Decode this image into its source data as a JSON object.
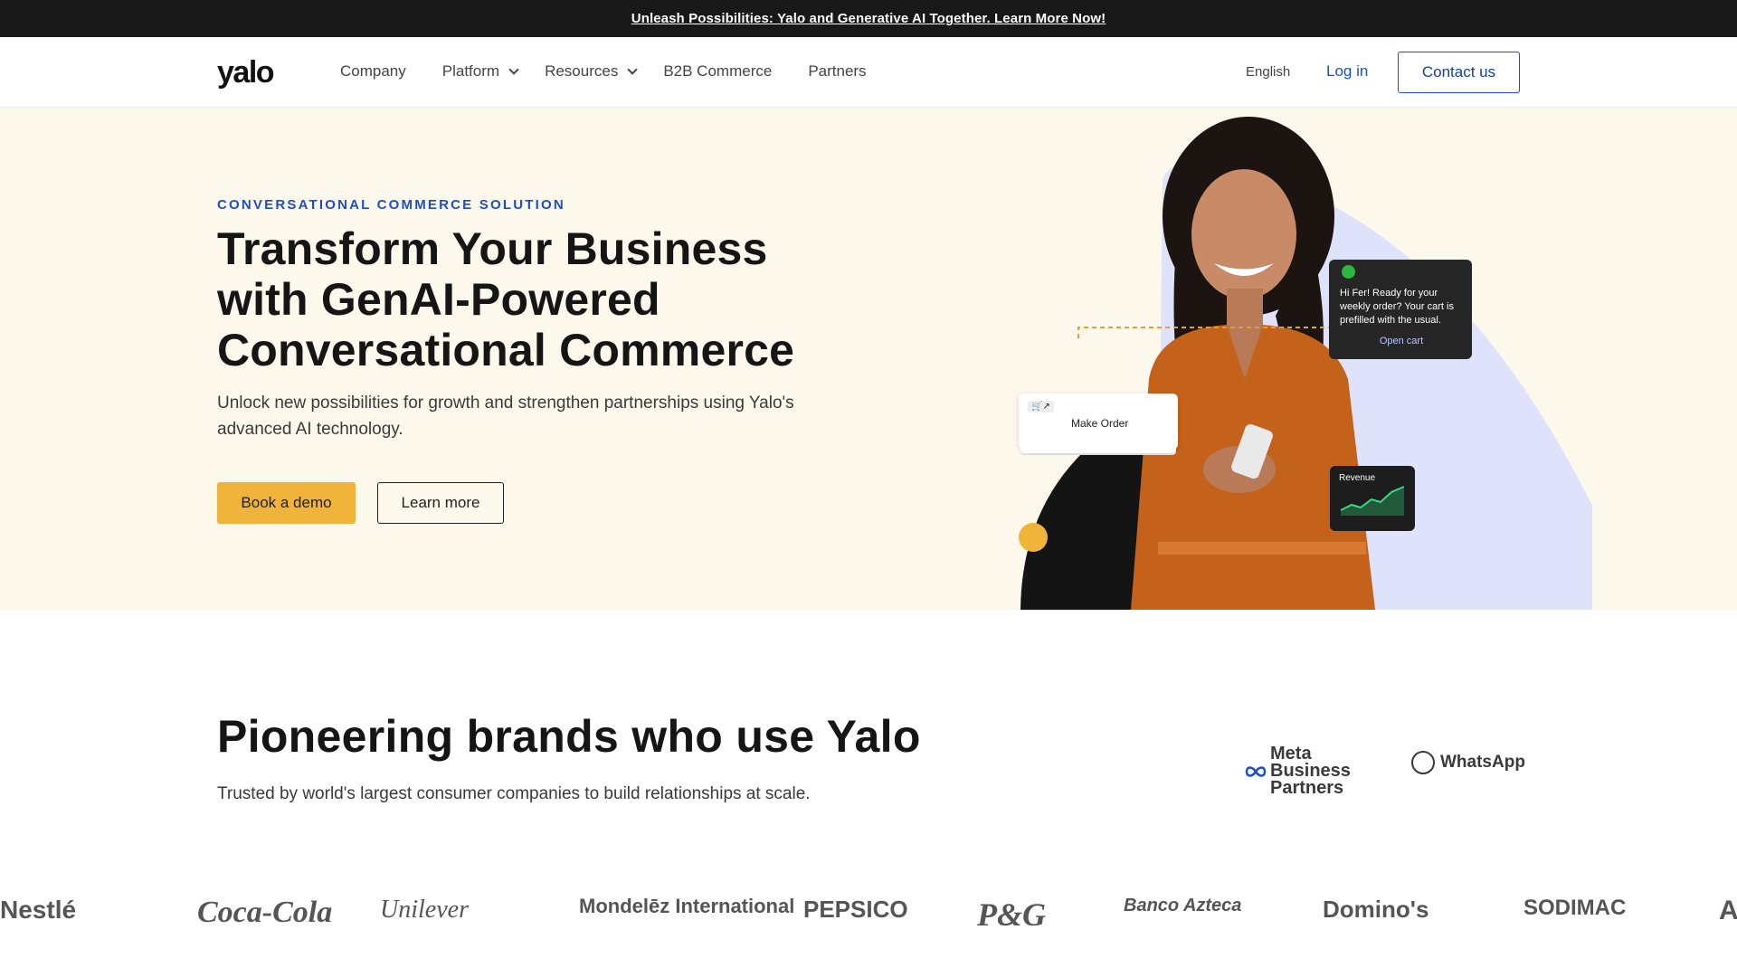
{
  "announcement": {
    "text": "Unleash Possibilities: Yalo and Generative AI Together. Learn More Now!"
  },
  "nav": {
    "logo": "yalo",
    "items": [
      {
        "label": "Company",
        "dropdown": false
      },
      {
        "label": "Platform",
        "dropdown": true
      },
      {
        "label": "Resources",
        "dropdown": true
      },
      {
        "label": "B2B Commerce",
        "dropdown": false
      },
      {
        "label": "Partners",
        "dropdown": false
      }
    ],
    "language": "English",
    "login": "Log in",
    "contact": "Contact us"
  },
  "hero": {
    "eyebrow": "CONVERSATIONAL COMMERCE SOLUTION",
    "headline": "Transform Your Business with GenAI-Powered Conversational Commerce",
    "subtext": "Unlock new possibilities for growth and strengthen partnerships using Yalo's advanced AI technology.",
    "primary_cta": "Book a demo",
    "secondary_cta": "Learn more",
    "chat_message": "Hi Fer! Ready for your weekly order? Your cart is prefilled with the usual.",
    "chat_action": "Open cart",
    "order_label": "Make Order",
    "revenue_label": "Revenue"
  },
  "brands": {
    "title": "Pioneering brands who use Yalo",
    "subtitle": "Trusted by world's largest consumer companies to build relationships at scale.",
    "meta_partner": "Meta Business Partners",
    "whatsapp": "WhatsApp",
    "logos": [
      "Nestlé",
      "Coca-Cola",
      "Unilever",
      "Mondelēz International",
      "PEPSICO",
      "P&G",
      "Banco Azteca",
      "Domino's",
      "SODIMAC",
      "A"
    ]
  },
  "colors": {
    "accent_blue": "#1c4fc7",
    "cta_yellow": "#f0b43b",
    "hero_bg": "#fdf8ec",
    "topbar": "#181818"
  }
}
